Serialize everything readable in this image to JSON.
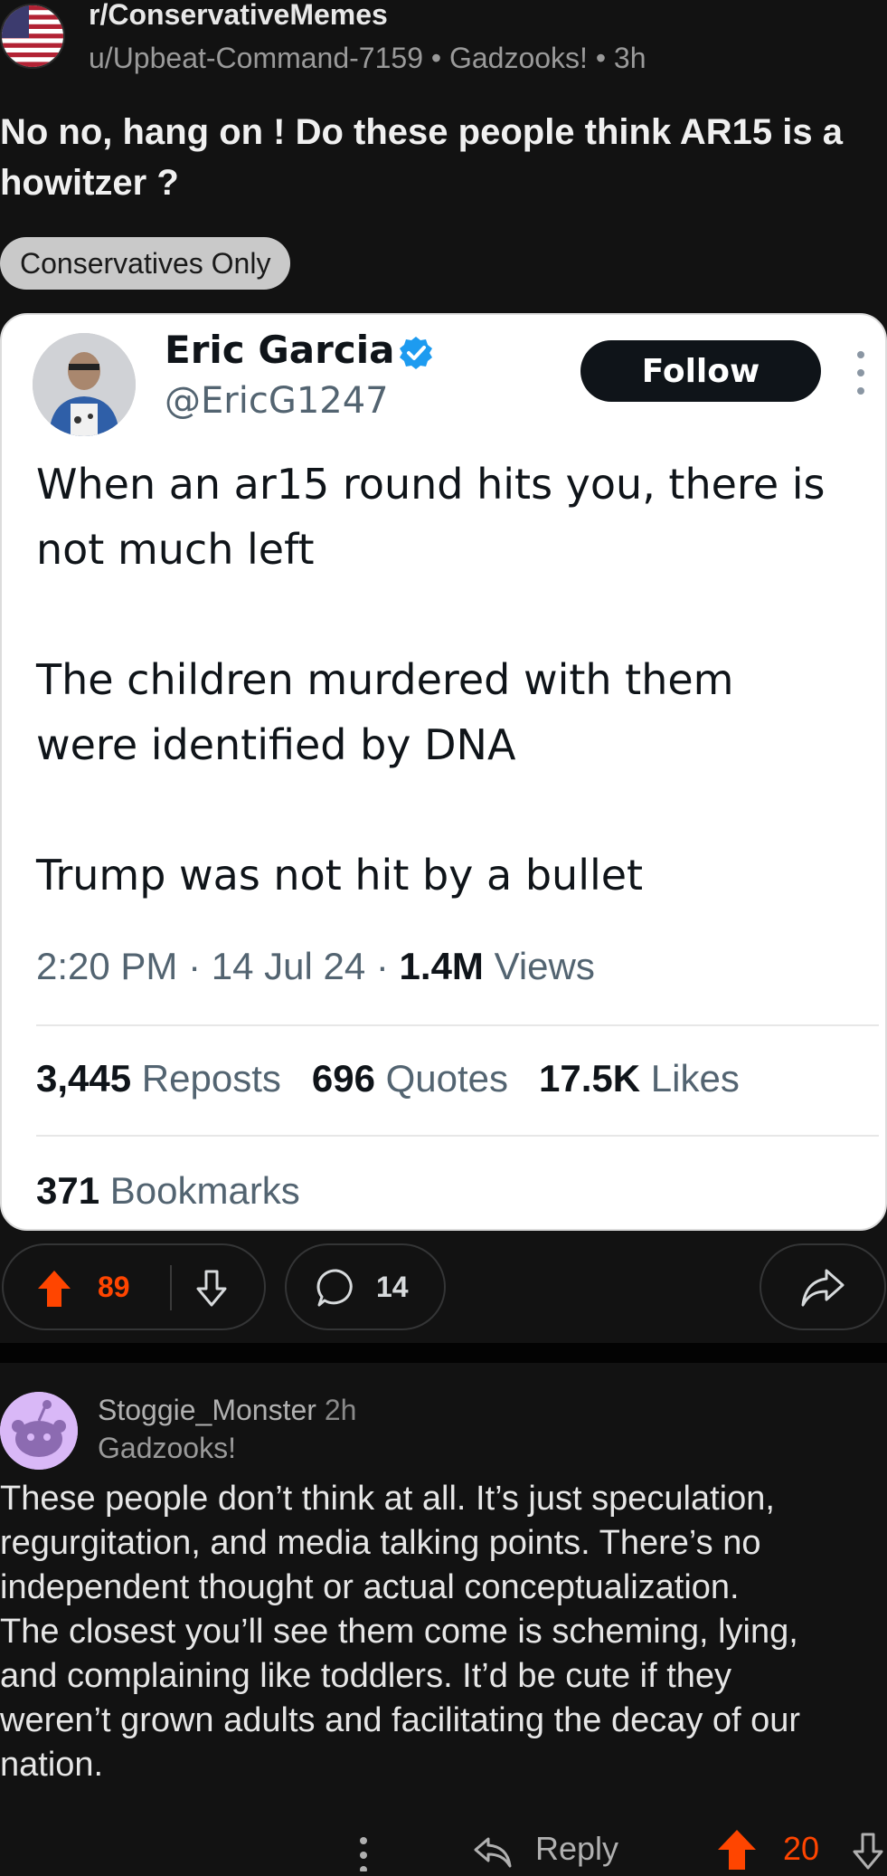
{
  "post": {
    "subreddit": "r/ConservativeMemes",
    "author": "u/Upbeat-Command-7159",
    "author_flair": "Gadzooks!",
    "age": "3h",
    "title": "No no, hang on ! Do these people think AR15 is a howitzer ?",
    "flair": "Conservatives Only",
    "upvotes": "89",
    "comments": "14"
  },
  "tweet": {
    "name": "Eric Garcia",
    "handle": "@EricG1247",
    "follow_label": "Follow",
    "lines": [
      "When an ar15 round hits you, there is",
      "not much left",
      "The children murdered with them",
      "were identified by DNA",
      "Trump was not hit by a bullet"
    ],
    "time": "2:20 PM",
    "date": "14 Jul 24",
    "views_count": "1.4M",
    "views_label": "Views",
    "reposts_count": "3,445",
    "reposts_label": "Reposts",
    "quotes_count": "696",
    "quotes_label": "Quotes",
    "likes_count": "17.5K",
    "likes_label": "Likes",
    "bookmarks_count": "371",
    "bookmarks_label": "Bookmarks"
  },
  "comment": {
    "username": "Stoggie_Monster",
    "age": "2h",
    "flair": "Gadzooks!",
    "body_lines": [
      "These people don’t think at all. It’s just speculation,",
      "regurgitation, and media talking points. There’s no",
      "independent thought or actual conceptualization.",
      "The closest you’ll see them come is scheming, lying,",
      "and complaining like toddlers. It’d be cute if they",
      "weren’t grown adults and facilitating the decay of our",
      "nation."
    ],
    "reply_label": "Reply",
    "score": "20"
  },
  "colors": {
    "background": "#121212",
    "upvote_orange": "#ff4500",
    "twitter_blue": "#1d9bf0"
  }
}
